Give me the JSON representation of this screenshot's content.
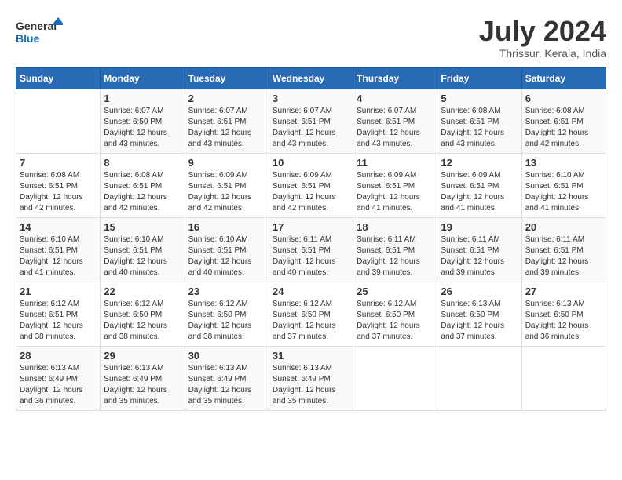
{
  "header": {
    "logo_general": "General",
    "logo_blue": "Blue",
    "title": "July 2024",
    "location": "Thrissur, Kerala, India"
  },
  "calendar": {
    "weekdays": [
      "Sunday",
      "Monday",
      "Tuesday",
      "Wednesday",
      "Thursday",
      "Friday",
      "Saturday"
    ],
    "weeks": [
      [
        {
          "day": "",
          "sunrise": "",
          "sunset": "",
          "daylight": ""
        },
        {
          "day": "1",
          "sunrise": "Sunrise: 6:07 AM",
          "sunset": "Sunset: 6:50 PM",
          "daylight": "Daylight: 12 hours and 43 minutes."
        },
        {
          "day": "2",
          "sunrise": "Sunrise: 6:07 AM",
          "sunset": "Sunset: 6:51 PM",
          "daylight": "Daylight: 12 hours and 43 minutes."
        },
        {
          "day": "3",
          "sunrise": "Sunrise: 6:07 AM",
          "sunset": "Sunset: 6:51 PM",
          "daylight": "Daylight: 12 hours and 43 minutes."
        },
        {
          "day": "4",
          "sunrise": "Sunrise: 6:07 AM",
          "sunset": "Sunset: 6:51 PM",
          "daylight": "Daylight: 12 hours and 43 minutes."
        },
        {
          "day": "5",
          "sunrise": "Sunrise: 6:08 AM",
          "sunset": "Sunset: 6:51 PM",
          "daylight": "Daylight: 12 hours and 43 minutes."
        },
        {
          "day": "6",
          "sunrise": "Sunrise: 6:08 AM",
          "sunset": "Sunset: 6:51 PM",
          "daylight": "Daylight: 12 hours and 42 minutes."
        }
      ],
      [
        {
          "day": "7",
          "sunrise": "Sunrise: 6:08 AM",
          "sunset": "Sunset: 6:51 PM",
          "daylight": "Daylight: 12 hours and 42 minutes."
        },
        {
          "day": "8",
          "sunrise": "Sunrise: 6:08 AM",
          "sunset": "Sunset: 6:51 PM",
          "daylight": "Daylight: 12 hours and 42 minutes."
        },
        {
          "day": "9",
          "sunrise": "Sunrise: 6:09 AM",
          "sunset": "Sunset: 6:51 PM",
          "daylight": "Daylight: 12 hours and 42 minutes."
        },
        {
          "day": "10",
          "sunrise": "Sunrise: 6:09 AM",
          "sunset": "Sunset: 6:51 PM",
          "daylight": "Daylight: 12 hours and 42 minutes."
        },
        {
          "day": "11",
          "sunrise": "Sunrise: 6:09 AM",
          "sunset": "Sunset: 6:51 PM",
          "daylight": "Daylight: 12 hours and 41 minutes."
        },
        {
          "day": "12",
          "sunrise": "Sunrise: 6:09 AM",
          "sunset": "Sunset: 6:51 PM",
          "daylight": "Daylight: 12 hours and 41 minutes."
        },
        {
          "day": "13",
          "sunrise": "Sunrise: 6:10 AM",
          "sunset": "Sunset: 6:51 PM",
          "daylight": "Daylight: 12 hours and 41 minutes."
        }
      ],
      [
        {
          "day": "14",
          "sunrise": "Sunrise: 6:10 AM",
          "sunset": "Sunset: 6:51 PM",
          "daylight": "Daylight: 12 hours and 41 minutes."
        },
        {
          "day": "15",
          "sunrise": "Sunrise: 6:10 AM",
          "sunset": "Sunset: 6:51 PM",
          "daylight": "Daylight: 12 hours and 40 minutes."
        },
        {
          "day": "16",
          "sunrise": "Sunrise: 6:10 AM",
          "sunset": "Sunset: 6:51 PM",
          "daylight": "Daylight: 12 hours and 40 minutes."
        },
        {
          "day": "17",
          "sunrise": "Sunrise: 6:11 AM",
          "sunset": "Sunset: 6:51 PM",
          "daylight": "Daylight: 12 hours and 40 minutes."
        },
        {
          "day": "18",
          "sunrise": "Sunrise: 6:11 AM",
          "sunset": "Sunset: 6:51 PM",
          "daylight": "Daylight: 12 hours and 39 minutes."
        },
        {
          "day": "19",
          "sunrise": "Sunrise: 6:11 AM",
          "sunset": "Sunset: 6:51 PM",
          "daylight": "Daylight: 12 hours and 39 minutes."
        },
        {
          "day": "20",
          "sunrise": "Sunrise: 6:11 AM",
          "sunset": "Sunset: 6:51 PM",
          "daylight": "Daylight: 12 hours and 39 minutes."
        }
      ],
      [
        {
          "day": "21",
          "sunrise": "Sunrise: 6:12 AM",
          "sunset": "Sunset: 6:51 PM",
          "daylight": "Daylight: 12 hours and 38 minutes."
        },
        {
          "day": "22",
          "sunrise": "Sunrise: 6:12 AM",
          "sunset": "Sunset: 6:50 PM",
          "daylight": "Daylight: 12 hours and 38 minutes."
        },
        {
          "day": "23",
          "sunrise": "Sunrise: 6:12 AM",
          "sunset": "Sunset: 6:50 PM",
          "daylight": "Daylight: 12 hours and 38 minutes."
        },
        {
          "day": "24",
          "sunrise": "Sunrise: 6:12 AM",
          "sunset": "Sunset: 6:50 PM",
          "daylight": "Daylight: 12 hours and 37 minutes."
        },
        {
          "day": "25",
          "sunrise": "Sunrise: 6:12 AM",
          "sunset": "Sunset: 6:50 PM",
          "daylight": "Daylight: 12 hours and 37 minutes."
        },
        {
          "day": "26",
          "sunrise": "Sunrise: 6:13 AM",
          "sunset": "Sunset: 6:50 PM",
          "daylight": "Daylight: 12 hours and 37 minutes."
        },
        {
          "day": "27",
          "sunrise": "Sunrise: 6:13 AM",
          "sunset": "Sunset: 6:50 PM",
          "daylight": "Daylight: 12 hours and 36 minutes."
        }
      ],
      [
        {
          "day": "28",
          "sunrise": "Sunrise: 6:13 AM",
          "sunset": "Sunset: 6:49 PM",
          "daylight": "Daylight: 12 hours and 36 minutes."
        },
        {
          "day": "29",
          "sunrise": "Sunrise: 6:13 AM",
          "sunset": "Sunset: 6:49 PM",
          "daylight": "Daylight: 12 hours and 35 minutes."
        },
        {
          "day": "30",
          "sunrise": "Sunrise: 6:13 AM",
          "sunset": "Sunset: 6:49 PM",
          "daylight": "Daylight: 12 hours and 35 minutes."
        },
        {
          "day": "31",
          "sunrise": "Sunrise: 6:13 AM",
          "sunset": "Sunset: 6:49 PM",
          "daylight": "Daylight: 12 hours and 35 minutes."
        },
        {
          "day": "",
          "sunrise": "",
          "sunset": "",
          "daylight": ""
        },
        {
          "day": "",
          "sunrise": "",
          "sunset": "",
          "daylight": ""
        },
        {
          "day": "",
          "sunrise": "",
          "sunset": "",
          "daylight": ""
        }
      ]
    ]
  }
}
